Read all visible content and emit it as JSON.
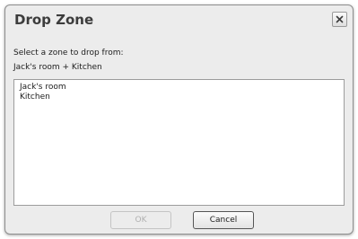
{
  "dialog": {
    "title": "Drop Zone",
    "close_icon": "close-icon",
    "prompt": "Select a zone to drop from:",
    "current_selection": "Jack's room + Kitchen",
    "zones": [
      {
        "label": "Jack's room"
      },
      {
        "label": "Kitchen"
      }
    ],
    "buttons": {
      "ok_label": "OK",
      "ok_enabled": false,
      "cancel_label": "Cancel"
    }
  }
}
